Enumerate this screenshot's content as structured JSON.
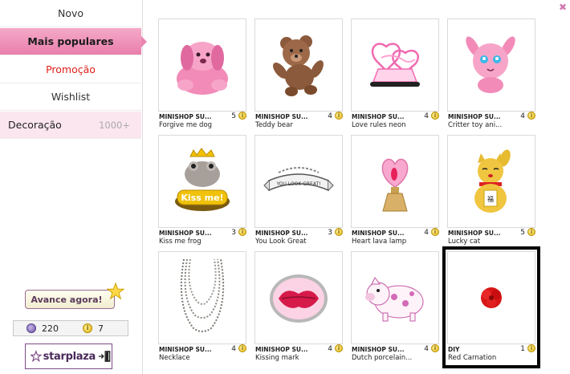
{
  "sidebar": {
    "items": [
      {
        "label": "Novo"
      },
      {
        "label": "Mais populares"
      },
      {
        "label": "Promoção"
      },
      {
        "label": "Wishlist"
      },
      {
        "label": "Decoração",
        "count": "1000+"
      }
    ],
    "advance_label": "Avance agora!",
    "wallet": {
      "stars": "220",
      "coins": "7"
    },
    "starplaza_label": "starplaza"
  },
  "close_label": "✖",
  "items": [
    {
      "seller": "MINISHOP SU...",
      "name": "Forgive me dog",
      "price": "5",
      "icon": "pink-dog-plush"
    },
    {
      "seller": "MINISHOP SU...",
      "name": "Teddy bear",
      "price": "4",
      "icon": "teddy-bear"
    },
    {
      "seller": "MINISHOP SU...",
      "name": "Love rules neon",
      "price": "4",
      "icon": "love-rules-neon-sign"
    },
    {
      "seller": "MINISHOP SU...",
      "name": "Critter toy ani...",
      "price": "4",
      "icon": "pink-critter-toy"
    },
    {
      "seller": "MINISHOP SU...",
      "name": "Kiss me frog",
      "price": "3",
      "icon": "kiss-me-frog"
    },
    {
      "seller": "MINISHOP SU...",
      "name": "You Look Great",
      "price": "3",
      "icon": "you-look-great-banner"
    },
    {
      "seller": "MINISHOP SU...",
      "name": "Heart lava lamp",
      "price": "4",
      "icon": "heart-lava-lamp"
    },
    {
      "seller": "MINISHOP SU...",
      "name": "Lucky cat",
      "price": "5",
      "icon": "lucky-cat"
    },
    {
      "seller": "MINISHOP SU...",
      "name": "Necklace",
      "price": "4",
      "icon": "pearl-necklace"
    },
    {
      "seller": "MINISHOP SU...",
      "name": "Kissing mark",
      "price": "4",
      "icon": "kissing-lips-mark"
    },
    {
      "seller": "MINISHOP SU...",
      "name": "Dutch porcelain...",
      "price": "4",
      "icon": "porcelain-pig"
    },
    {
      "seller": "DIY",
      "name": "Red Carnation",
      "price": "1",
      "icon": "red-carnation"
    }
  ],
  "colors": {
    "accent": "#e97fac",
    "promo": "#e0201c",
    "selection": "#000000"
  }
}
